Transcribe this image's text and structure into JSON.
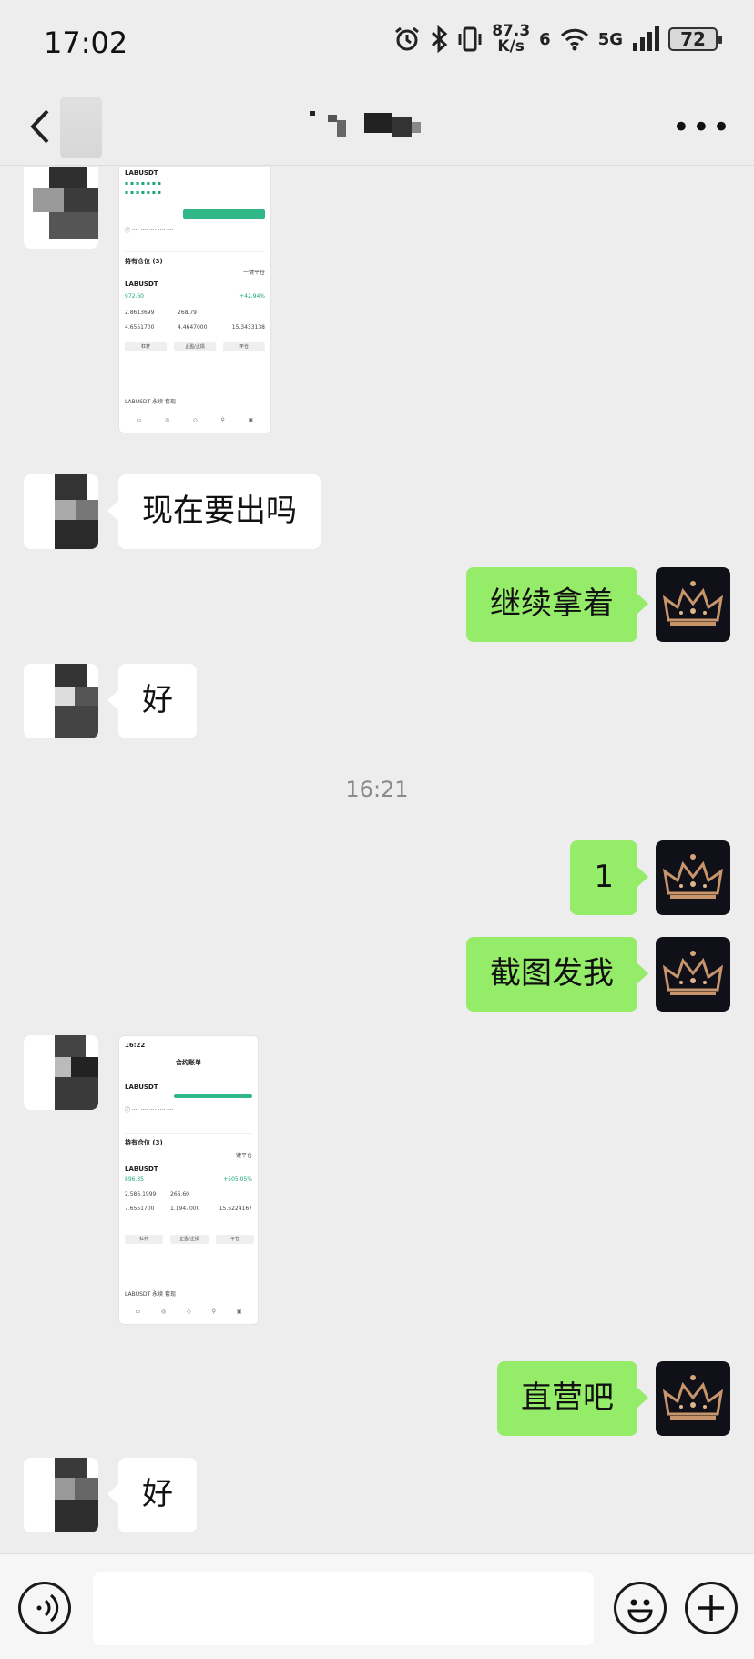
{
  "status_bar": {
    "time": "17:02",
    "net_speed_value": "87.3",
    "net_speed_unit": "K/s",
    "signal_label": "5G",
    "wifi_label": "6",
    "battery": "72"
  },
  "header": {
    "more_icon": "more-dots-icon"
  },
  "messages": {
    "m1_text": "现在要出吗",
    "m2_text": "继续拿着",
    "m3_text": "好",
    "timestamp": "16:21",
    "m4_text": "1",
    "m5_text": "截图发我",
    "m6_text": "直营吧",
    "m7_text": "好"
  },
  "thumb1": {
    "symbol": "LABUSDT",
    "price_text": "972.60",
    "pct_text": "+42.94%",
    "open_btn": "买入/做多",
    "positions_tab": "持有仓位 (3)",
    "one_click": "一键平仓",
    "btn_a": "杠杆",
    "btn_b": "止盈/止损",
    "btn_c": "平仓",
    "value_a": "2.8613699",
    "value_b": "268.79",
    "value_c": "4.6551700",
    "value_d": "4.4647000",
    "value_e": "15.3433138",
    "footer": "LABUSDT 永续 套现"
  },
  "thumb2": {
    "time": "16:22",
    "title": "合约账单",
    "symbol": "LABUSDT",
    "positions_tab": "持有仓位 (3)",
    "one_click": "一键平仓",
    "price_text": "896.35",
    "pct_text": "+505.05%",
    "value_a": "2.586.1999",
    "value_b": "266.60",
    "value_c": "7.6551700",
    "value_d": "1.1947000",
    "value_e": "15.5224167",
    "btn_a": "杠杆",
    "btn_b": "止盈/止损",
    "btn_c": "平仓",
    "footer": "LABUSDT 永续 套现"
  },
  "icons": {
    "voice": "voice-icon",
    "emoji": "emoji-icon",
    "plus": "plus-icon",
    "back": "back-arrow-icon"
  },
  "colors": {
    "background": "#ededed",
    "bubble_left": "#ffffff",
    "bubble_right": "#95ec69",
    "accent_green": "#31b888"
  }
}
